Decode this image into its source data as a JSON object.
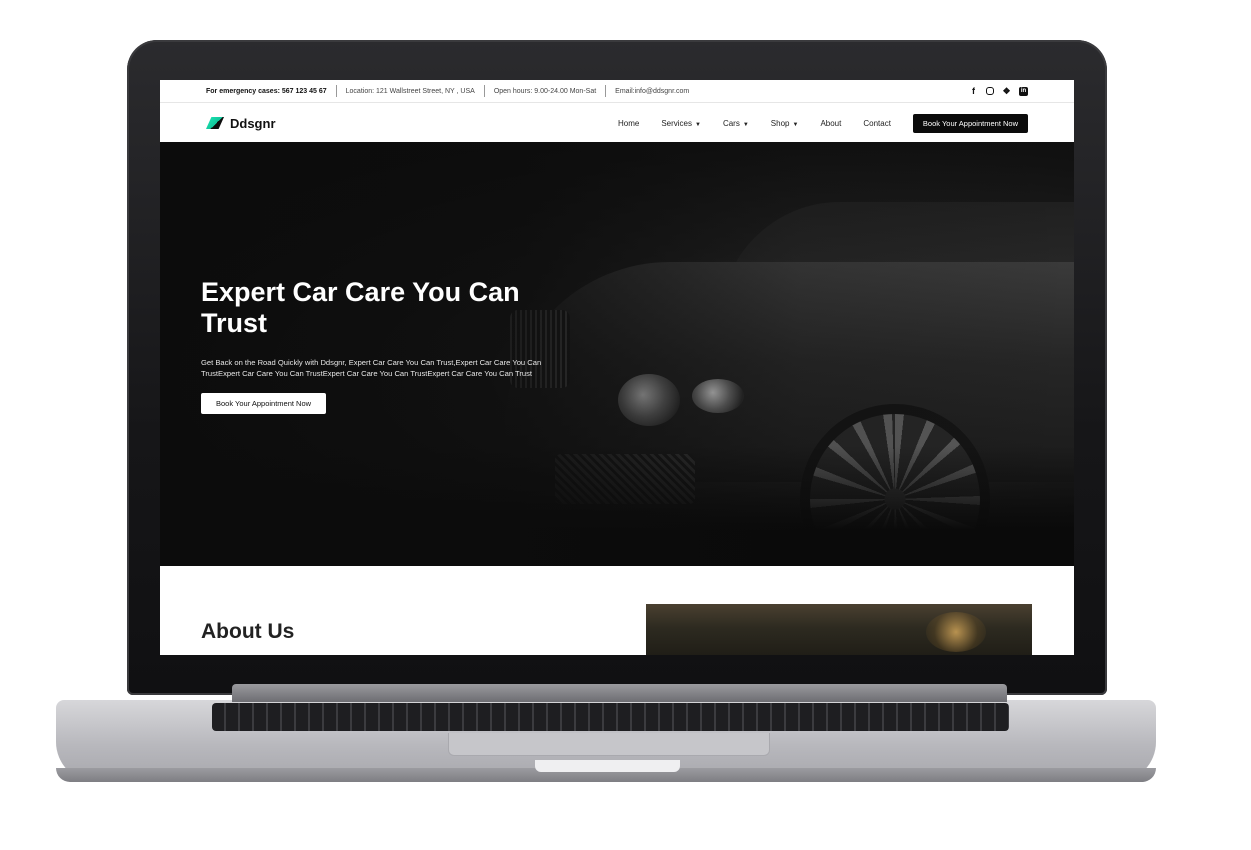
{
  "topbar": {
    "emergency": "For emergency cases: 567 123 45 67",
    "location": "Location: 121 Wallstreet Street, NY , USA",
    "hours": "Open hours: 9.00-24.00 Mon-Sat",
    "email": "Email:info@ddsgnr.com",
    "social_icons": [
      "facebook-icon",
      "instagram-icon",
      "twitter-icon",
      "linkedin-icon"
    ]
  },
  "navbar": {
    "logo_text": "Ddsgnr",
    "items": [
      {
        "label": "Home"
      },
      {
        "label": "Services"
      },
      {
        "label": "Cars"
      },
      {
        "label": "Shop"
      },
      {
        "label": "About"
      },
      {
        "label": "Contact"
      }
    ],
    "cta": "Book Your Appointment Now"
  },
  "hero": {
    "title": "Expert Car Care You Can Trust",
    "text": "Get Back on the Road Quickly with Ddsgnr, Expert Car Care You Can Trust,Expert Car Care You Can TrustExpert Car Care You Can TrustExpert Car Care You Can TrustExpert Car Care You Can Trust",
    "button": "Book Your Appointment Now"
  },
  "about": {
    "title": "About Us"
  },
  "colors": {
    "accent": "#1de9b6",
    "dark": "#0b0b0b",
    "white": "#ffffff"
  }
}
